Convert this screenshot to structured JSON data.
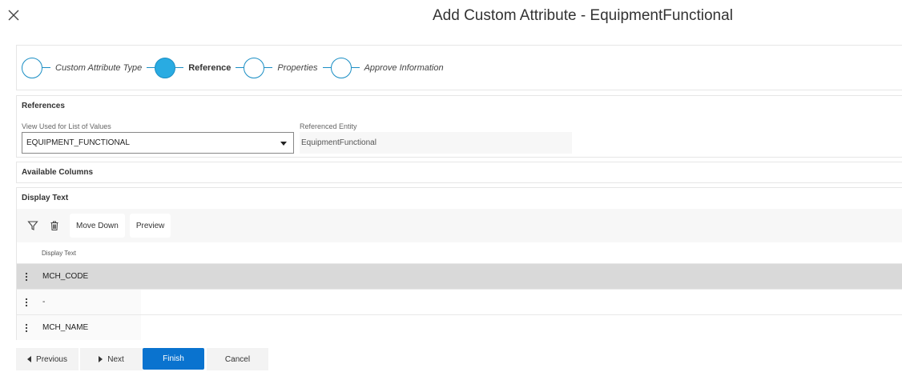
{
  "dialog": {
    "title": "Add Custom Attribute - EquipmentFunctional"
  },
  "stepper": {
    "steps": [
      {
        "label": "Custom Attribute Type",
        "active": false
      },
      {
        "label": "Reference",
        "active": true
      },
      {
        "label": "Properties",
        "active": false
      },
      {
        "label": "Approve Information",
        "active": false
      }
    ]
  },
  "references": {
    "heading": "References",
    "view_label": "View Used for List of Values",
    "view_value": "EQUIPMENT_FUNCTIONAL",
    "entity_label": "Referenced Entity",
    "entity_value": "EquipmentFunctional"
  },
  "available_columns": {
    "heading": "Available Columns"
  },
  "display_text": {
    "heading": "Display Text",
    "toolbar": {
      "move_down": "Move Down",
      "preview": "Preview"
    },
    "column_header": "Display Text",
    "rows": [
      {
        "text": "MCH_CODE"
      },
      {
        "text": "-"
      },
      {
        "text": "MCH_NAME"
      }
    ]
  },
  "footer": {
    "previous": "Previous",
    "next": "Next",
    "finish": "Finish",
    "cancel": "Cancel"
  },
  "colors": {
    "accent": "#29abe2",
    "primary_button": "#0a73cf",
    "selected_row": "#d9d9d9"
  }
}
